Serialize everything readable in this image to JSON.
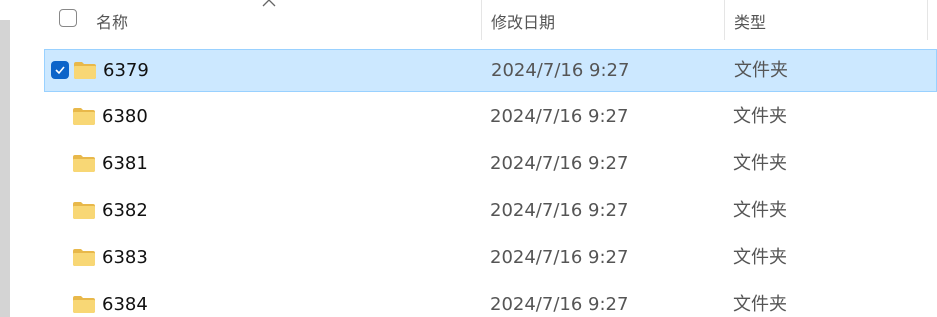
{
  "header": {
    "columns": {
      "name": "名称",
      "date": "修改日期",
      "type": "类型"
    }
  },
  "rows": [
    {
      "name": "6379",
      "date": "2024/7/16 9:27",
      "type": "文件夹",
      "selected": true
    },
    {
      "name": "6380",
      "date": "2024/7/16 9:27",
      "type": "文件夹",
      "selected": false
    },
    {
      "name": "6381",
      "date": "2024/7/16 9:27",
      "type": "文件夹",
      "selected": false
    },
    {
      "name": "6382",
      "date": "2024/7/16 9:27",
      "type": "文件夹",
      "selected": false
    },
    {
      "name": "6383",
      "date": "2024/7/16 9:27",
      "type": "文件夹",
      "selected": false
    },
    {
      "name": "6384",
      "date": "2024/7/16 9:27",
      "type": "文件夹",
      "selected": false
    }
  ],
  "icons": {
    "folder": "folder-icon",
    "checkbox": "checkbox-icon",
    "sort": "sort-up-icon"
  },
  "colors": {
    "selection_bg": "#cce8ff",
    "selection_border": "#99d1ff",
    "check_accent": "#0c64c9",
    "folder_body": "#f8d775",
    "folder_tab": "#e8b84a"
  }
}
